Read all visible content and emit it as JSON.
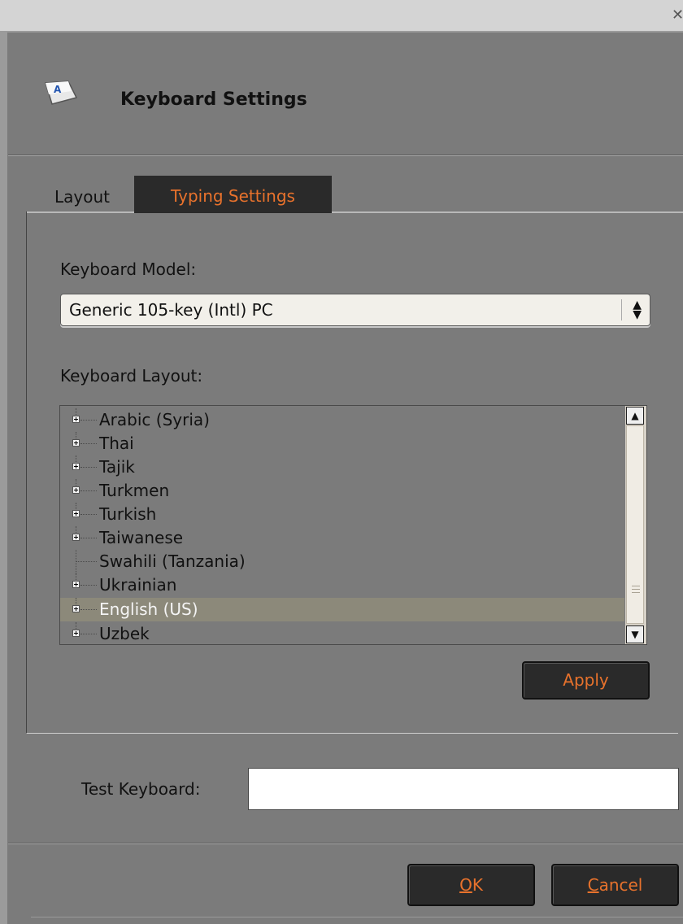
{
  "dialog": {
    "title": "Keyboard Settings",
    "icon": "keyboard-key-icon"
  },
  "tabs": [
    {
      "label": "Layout",
      "active": false
    },
    {
      "label": "Typing Settings",
      "active": true
    }
  ],
  "layout_tab": {
    "model_label": "Keyboard Model:",
    "model_value": "Generic 105-key (Intl) PC",
    "layout_label": "Keyboard Layout:",
    "layouts": [
      {
        "label": "Arabic (Syria)",
        "expandable": true,
        "selected": false
      },
      {
        "label": "Thai",
        "expandable": true,
        "selected": false
      },
      {
        "label": "Tajik",
        "expandable": true,
        "selected": false
      },
      {
        "label": "Turkmen",
        "expandable": true,
        "selected": false
      },
      {
        "label": "Turkish",
        "expandable": true,
        "selected": false
      },
      {
        "label": "Taiwanese",
        "expandable": true,
        "selected": false
      },
      {
        "label": "Swahili (Tanzania)",
        "expandable": false,
        "selected": false
      },
      {
        "label": "Ukrainian",
        "expandable": true,
        "selected": false
      },
      {
        "label": "English (US)",
        "expandable": true,
        "selected": true
      },
      {
        "label": "Uzbek",
        "expandable": true,
        "selected": false
      }
    ],
    "apply_label": "Apply"
  },
  "test": {
    "label": "Test Keyboard:",
    "value": ""
  },
  "footer": {
    "ok_label": "OK",
    "ok_mnemonic": "O",
    "ok_rest": "K",
    "cancel_label": "Cancel",
    "cancel_mnemonic": "C",
    "cancel_rest": "ancel"
  },
  "colors": {
    "background": "#7b7b7b",
    "accent": "#e8722c",
    "button_bg": "#2a2a2a",
    "selection": "#8c897a"
  }
}
